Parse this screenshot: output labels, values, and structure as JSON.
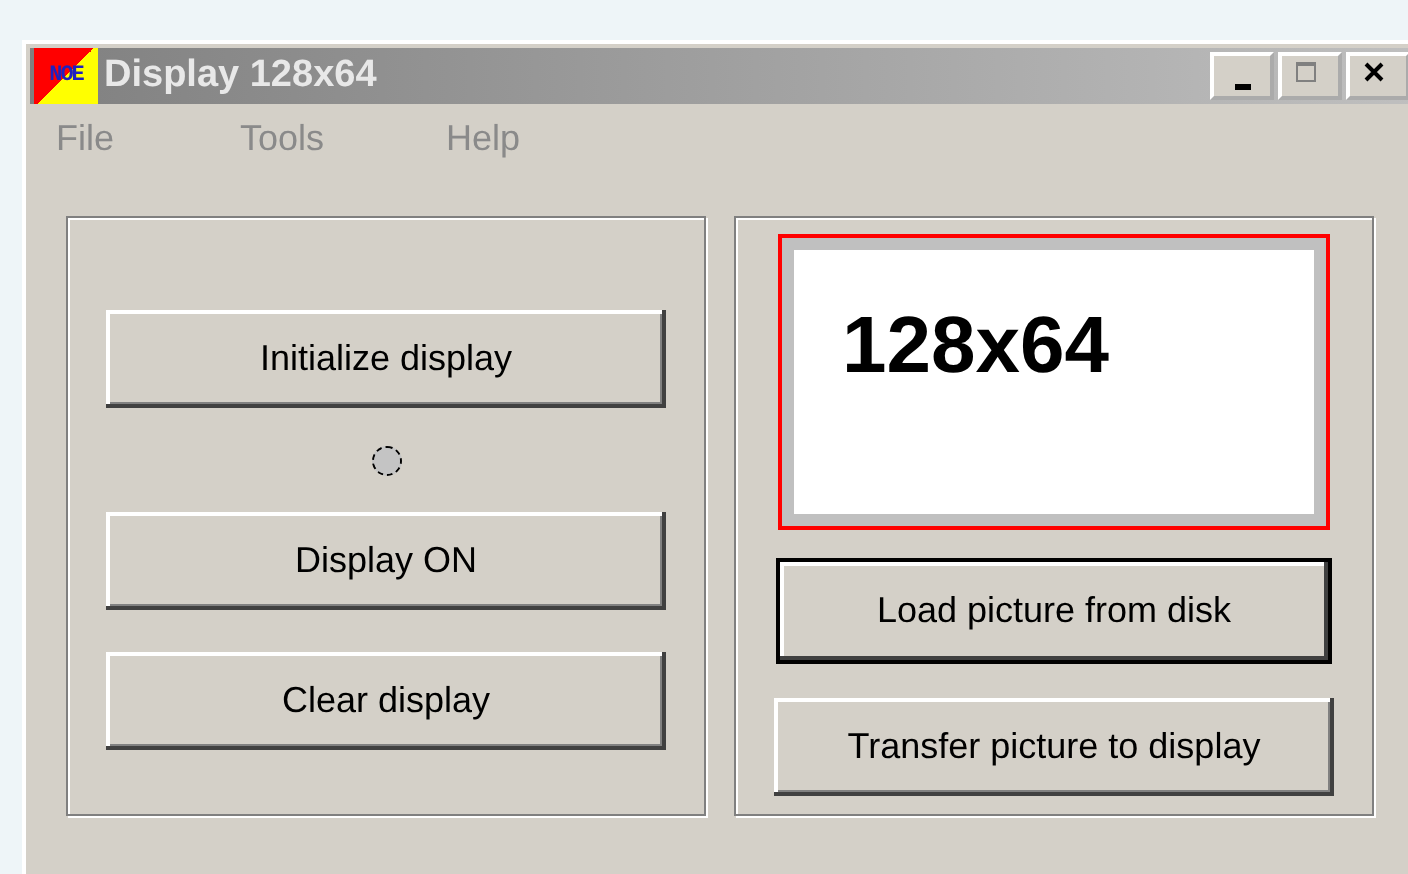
{
  "window": {
    "title": "Display 128x64",
    "icon_text": "NOE",
    "active": false
  },
  "menu": [
    {
      "label": "File",
      "disabled": true
    },
    {
      "label": "Tools",
      "disabled": true
    },
    {
      "label": "Help",
      "disabled": true
    }
  ],
  "left_panel": {
    "buttons": [
      {
        "kind": "button",
        "label": "Initialize display",
        "focused": false
      },
      {
        "kind": "led",
        "on": false
      },
      {
        "kind": "button",
        "label": "Display ON",
        "focused": false
      },
      {
        "kind": "button",
        "label": "Clear display",
        "focused": false
      }
    ]
  },
  "right_panel": {
    "preview": {
      "text": "128x64"
    },
    "buttons": [
      {
        "label": "Load picture from disk",
        "focused": true
      },
      {
        "label": "Transfer picture to display",
        "focused": false
      }
    ]
  }
}
